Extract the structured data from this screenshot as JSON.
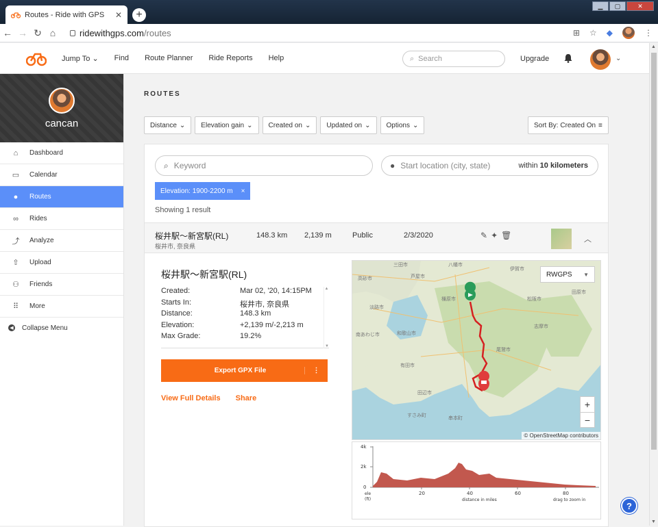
{
  "browser": {
    "tab_title": "Routes - Ride with GPS",
    "url_host": "ridewithgps.com",
    "url_path": "/routes"
  },
  "header": {
    "nav": [
      "Jump To",
      "Find",
      "Route Planner",
      "Ride Reports",
      "Help"
    ],
    "search_placeholder": "Search",
    "upgrade": "Upgrade"
  },
  "sidebar": {
    "user_name": "cancan",
    "items": [
      {
        "label": "Dashboard",
        "icon": "home-icon"
      },
      {
        "label": "Calendar",
        "icon": "calendar-icon"
      },
      {
        "label": "Routes",
        "icon": "pin-icon"
      },
      {
        "label": "Rides",
        "icon": "bike-icon"
      },
      {
        "label": "Analyze",
        "icon": "trend-icon"
      },
      {
        "label": "Upload",
        "icon": "upload-icon"
      },
      {
        "label": "Friends",
        "icon": "people-icon"
      },
      {
        "label": "More",
        "icon": "grid-icon"
      }
    ],
    "collapse_label": "Collapse Menu",
    "active_index": 2
  },
  "main": {
    "heading": "ROUTES",
    "filters": [
      "Distance",
      "Elevation gain",
      "Created on",
      "Updated on",
      "Options"
    ],
    "sort_label": "Sort By: Created On",
    "keyword_placeholder": "Keyword",
    "location_placeholder": "Start location (city, state)",
    "within_prefix": "within",
    "within_value": "10 kilometers",
    "chip_label": "Elevation: 1900-2200 m",
    "chip_close": "×",
    "showing": "Showing 1 result"
  },
  "route": {
    "name": "桜井駅～新宮駅(RL)",
    "location": "桜井市, 奈良県",
    "distance": "148.3 km",
    "elevation": "2,139 m",
    "visibility": "Public",
    "date": "2/3/2020"
  },
  "details": {
    "title": "桜井駅～新宮駅(RL)",
    "rows": [
      {
        "k": "Created:",
        "v": "Mar 02, '20, 14:15PM"
      },
      {
        "k": "Starts In:",
        "v": "桜井市, 奈良県"
      },
      {
        "k": "Distance:",
        "v": "148.3 km"
      },
      {
        "k": "Elevation:",
        "v": "+2,139 m/-2,213 m"
      },
      {
        "k": "Max Grade:",
        "v": "19.2%"
      }
    ],
    "export_label": "Export GPX File",
    "export_more": "⋮",
    "view_full": "View Full Details",
    "share": "Share"
  },
  "map": {
    "layer": "RWGPS",
    "zoom_in": "+",
    "zoom_out": "−",
    "attribution": "© OpenStreetMap contributors"
  },
  "elevation_chart": {
    "y_ticks": [
      "4k",
      "2k",
      "0"
    ],
    "x_ticks": [
      "20",
      "40",
      "60",
      "80"
    ],
    "unit_top": "ele",
    "unit_bottom": "(ft)",
    "x_label": "distance in miles",
    "hint": "drag to zoom in"
  },
  "help_icon": "?",
  "colors": {
    "accent": "#f86b15",
    "active": "#5b8ff9",
    "elevation_fill": "#c2584e"
  }
}
